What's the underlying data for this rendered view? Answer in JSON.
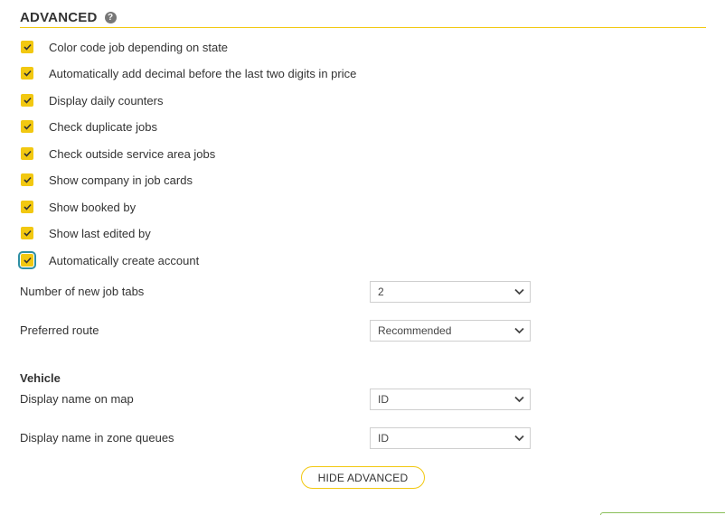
{
  "section": {
    "title": "ADVANCED",
    "help_glyph": "?"
  },
  "options": [
    {
      "label": "Color code job depending on state",
      "checked": true
    },
    {
      "label": "Automatically add decimal before the last two digits in price",
      "checked": true
    },
    {
      "label": "Display daily counters",
      "checked": true
    },
    {
      "label": "Check duplicate jobs",
      "checked": true
    },
    {
      "label": "Check outside service area jobs",
      "checked": true
    },
    {
      "label": "Show company in job cards",
      "checked": true
    },
    {
      "label": "Show booked by",
      "checked": true
    },
    {
      "label": "Show last edited by",
      "checked": true
    },
    {
      "label": "Automatically create account",
      "checked": true
    }
  ],
  "fields": {
    "new_job_tabs": {
      "label": "Number of new job tabs",
      "value": "2"
    },
    "preferred_route": {
      "label": "Preferred route",
      "value": "Recommended"
    }
  },
  "vehicle": {
    "heading": "Vehicle",
    "name_on_map": {
      "label": "Display name on map",
      "value": "ID"
    },
    "name_in_zone_queues": {
      "label": "Display name in zone queues",
      "value": "ID"
    }
  },
  "actions": {
    "hide_advanced": "HIDE ADVANCED"
  },
  "colors": {
    "accent": "#f2c811",
    "focus": "#2f8fa4"
  }
}
